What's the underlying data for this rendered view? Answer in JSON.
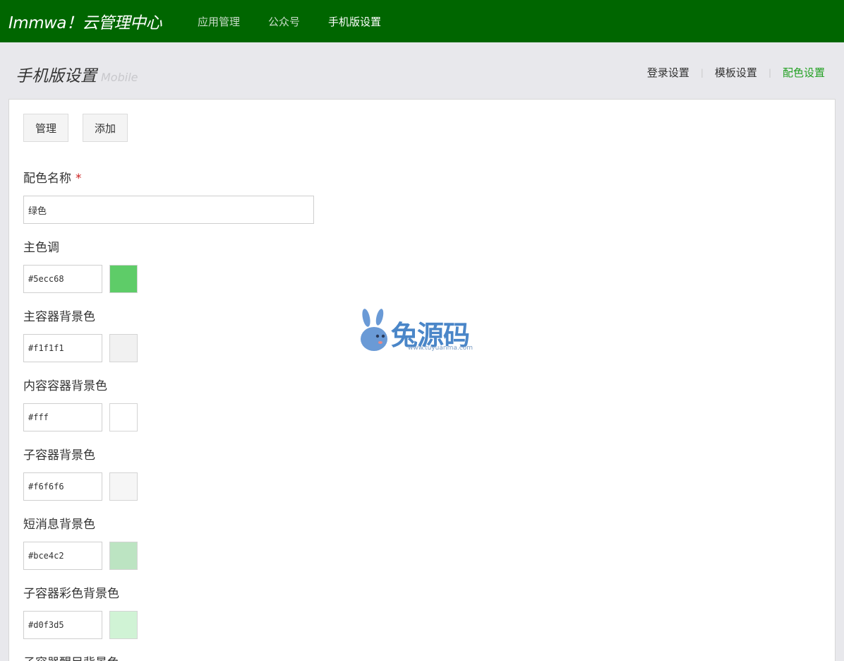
{
  "topnav": {
    "brand": "Immwa！云管理中心",
    "items": [
      {
        "label": "应用管理",
        "active": false
      },
      {
        "label": "公众号",
        "active": false
      },
      {
        "label": "手机版设置",
        "active": true
      }
    ],
    "bg_color": "#006600"
  },
  "header": {
    "title": "手机版设置",
    "subtitle": "Mobile",
    "subnav": [
      {
        "label": "登录设置",
        "active": false
      },
      {
        "label": "模板设置",
        "active": false
      },
      {
        "label": "配色设置",
        "active": true
      }
    ],
    "separator": "|"
  },
  "toolbar": {
    "manage_label": "管理",
    "add_label": "添加"
  },
  "form": {
    "name_label": "配色名称",
    "required_mark": "*",
    "name_value": "绿色",
    "fields": [
      {
        "label": "主色调",
        "value": "#5ecc68"
      },
      {
        "label": "主容器背景色",
        "value": "#f1f1f1"
      },
      {
        "label": "内容容器背景色",
        "value": "#fff"
      },
      {
        "label": "子容器背景色",
        "value": "#f6f6f6"
      },
      {
        "label": "短消息背景色",
        "value": "#bce4c2"
      },
      {
        "label": "子容器彩色背景色",
        "value": "#d0f3d5"
      },
      {
        "label": "子容器醒目背景色",
        "value": ""
      }
    ]
  },
  "watermark": {
    "text": "兔源码",
    "url": "www.tuyuanma.com"
  }
}
